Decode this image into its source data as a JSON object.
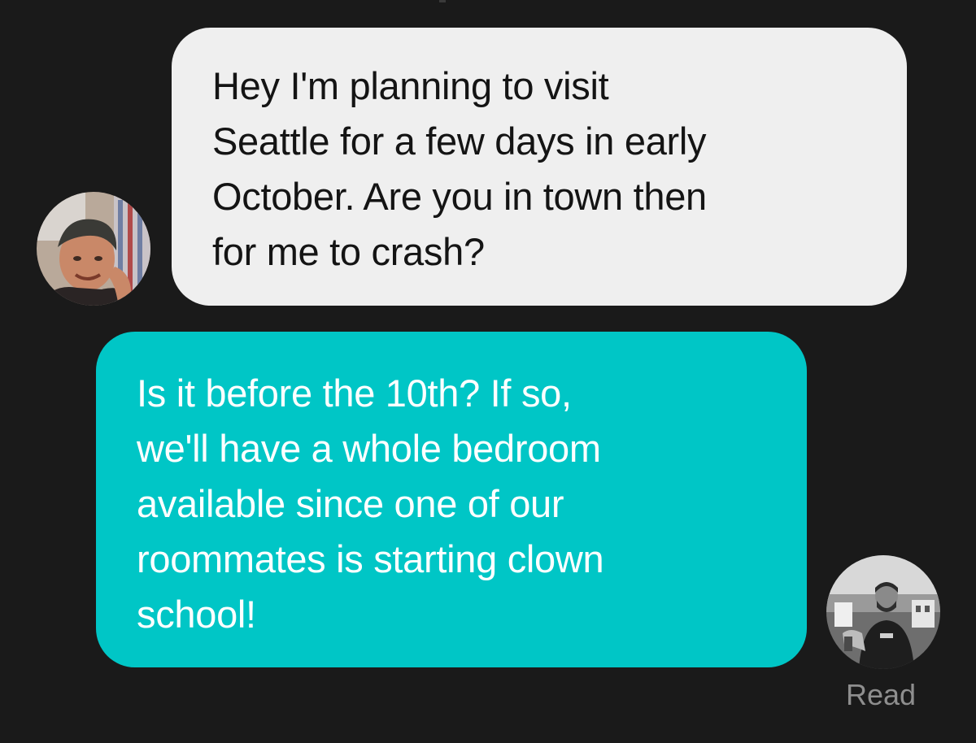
{
  "conversation": {
    "messages": [
      {
        "direction": "incoming",
        "lines": [
          "Hey I'm planning to visit",
          "Seattle for a few days in early",
          "October. Are you in town then",
          "for me to crash?"
        ]
      },
      {
        "direction": "outgoing",
        "lines": [
          "Is it before the 10th? If so,",
          "we'll have a whole bedroom",
          "available since one of our",
          "roommates is starting clown",
          "school!"
        ]
      }
    ],
    "read_receipt": "Read"
  },
  "colors": {
    "background": "#1a1a1a",
    "incoming_bubble": "#efefef",
    "outgoing_bubble": "#00c6c6",
    "receipt_text": "#8e8e8e"
  },
  "icons": {
    "sender_avatar": "avatar-photo",
    "recipient_avatar": "avatar-photo"
  }
}
